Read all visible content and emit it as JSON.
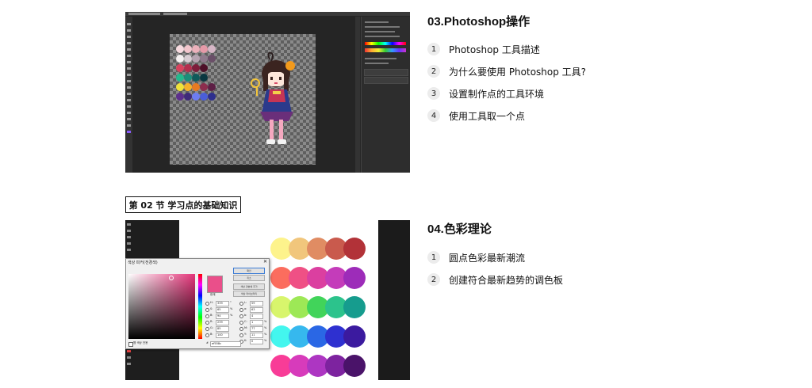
{
  "section_tag": "第 02 节 学习点的基础知识",
  "section3": {
    "title": "03.Photoshop操作",
    "items": [
      {
        "num": "1",
        "label": "Photoshop 工具描述"
      },
      {
        "num": "2",
        "label": "为什么要使用 Photoshop 工具?"
      },
      {
        "num": "3",
        "label": "设置制作点的工具环境"
      },
      {
        "num": "4",
        "label": "使用工具取一个点"
      }
    ]
  },
  "section4": {
    "title": "04.色彩理论",
    "items": [
      {
        "num": "1",
        "label": "圆点色彩最新潮流"
      },
      {
        "num": "2",
        "label": "创建符合最新趋势的调色板"
      }
    ]
  },
  "photoshop_palette": {
    "colors": [
      [
        "#f6dadf",
        "#f2c5cc",
        "#ebb1bb",
        "#e69aa8",
        "#d6b6c6"
      ],
      [
        "#f4f0f0",
        "#d8cdd3",
        "#b6a4b1",
        "#8f7a8c",
        "#6a4f68"
      ],
      [
        "#d8435e",
        "#b32e4d",
        "#7d1d3b",
        "#4d1028",
        ""
      ],
      [
        "#24b98d",
        "#1a8e7a",
        "#0f5a5a",
        "#0a3740",
        ""
      ],
      [
        "#f0e33a",
        "#f5b12b",
        "#e77a22",
        "#8c2d4d",
        "#5d1f45"
      ],
      [
        "#5d2f8d",
        "#3f2a7a",
        "#6d7cf0",
        "#4a5ed8",
        "#2e2f8e"
      ]
    ]
  },
  "color_picker": {
    "dialog_title": "색상 피커(전경색)",
    "buttons": [
      "확인",
      "취소",
      "색상 견본에 추가",
      "색상 라이브러리"
    ],
    "current_label": "현재",
    "fields_left": [
      {
        "k": "H:",
        "v": "339",
        "u": "°"
      },
      {
        "k": "S:",
        "v": "65",
        "u": "%"
      },
      {
        "k": "B:",
        "v": "94",
        "u": "%"
      },
      {
        "k": "R:",
        "v": "239",
        "u": ""
      },
      {
        "k": "G:",
        "v": "85",
        "u": ""
      },
      {
        "k": "B:",
        "v": "140",
        "u": ""
      }
    ],
    "fields_right": [
      {
        "k": "L:",
        "v": "59",
        "u": ""
      },
      {
        "k": "a:",
        "v": "63",
        "u": ""
      },
      {
        "k": "b:",
        "v": "4",
        "u": ""
      },
      {
        "k": "C:",
        "v": "1",
        "u": "%"
      },
      {
        "k": "M:",
        "v": "77",
        "u": "%"
      },
      {
        "k": "Y:",
        "v": "11",
        "u": "%"
      },
      {
        "k": "K:",
        "v": "0",
        "u": "%"
      }
    ],
    "hex_label": "#",
    "hex_value": "ef558c",
    "checkbox_label": "웹 색상 전용",
    "palette": [
      [
        "#fdf38c",
        "#f1c67c",
        "#e08c63",
        "#c95a4d",
        "#b23238"
      ],
      [
        "#fb6d5e",
        "#ef5085",
        "#db3fa0",
        "#c43cba",
        "#9d2cb9"
      ],
      [
        "#d8f56c",
        "#9de856",
        "#41d45a",
        "#2cc38c",
        "#169c8e"
      ],
      [
        "#43f6ee",
        "#36b8ee",
        "#2a67e5",
        "#2e30d0",
        "#3b1a9f"
      ],
      [
        "#f83c97",
        "#d73bbb",
        "#ad36c2",
        "#7d239f",
        "#4a1369"
      ]
    ]
  }
}
